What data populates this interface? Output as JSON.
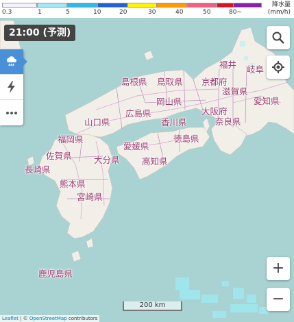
{
  "legend": {
    "ticks": [
      "0.3",
      "1",
      "5",
      "10",
      "20",
      "30",
      "40",
      "50",
      "80~"
    ],
    "colors": [
      "#f2f2ff",
      "#a0d2ff",
      "#218cff",
      "#0041ff",
      "#fff500",
      "#ff9900",
      "#ff2800",
      "#b40068",
      "#7a2e9e"
    ],
    "title": "降水量",
    "unit": "(mm/h)"
  },
  "time_badge": "21:00 (予測)",
  "toolbar": [
    {
      "icon": "rain-cloud-icon",
      "active": true
    },
    {
      "icon": "lightning-icon",
      "active": false
    },
    {
      "icon": "more-icon",
      "active": false
    }
  ],
  "controls": {
    "search": "search-icon",
    "locate": "locate-icon",
    "zoom_in": "+",
    "zoom_out": "−"
  },
  "scale": "200 km",
  "attribution": {
    "leaflet": "Leaflet",
    "sep": " | © ",
    "osm": "OpenStreetMap",
    "tail": " contributors"
  },
  "prefectures": [
    "福井",
    "岐阜",
    "島根県",
    "鳥取県",
    "京都府",
    "滋賀県",
    "愛知県",
    "岡山県",
    "広島県",
    "大阪府",
    "山口県",
    "香川県",
    "奈良県",
    "福岡県",
    "徳島県",
    "愛媛県",
    "佐賀県",
    "大分県",
    "高知県",
    "長崎県",
    "熊本県",
    "宮崎県",
    "鹿児島県"
  ],
  "colors": {
    "sea": "#a9d3d3",
    "land": "#f2efe9",
    "pref_label": "#9a3b6d",
    "border": "#b07ab9",
    "road": "#d9a0cf",
    "accent": "#4a90d9"
  }
}
